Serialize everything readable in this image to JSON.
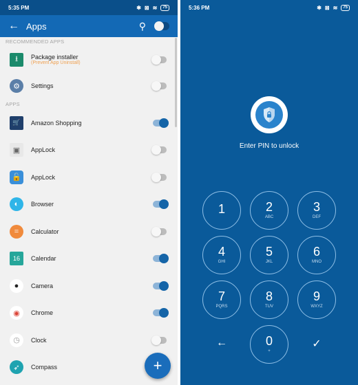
{
  "left": {
    "status": {
      "time": "5:35 PM",
      "battery": "75"
    },
    "appbar": {
      "title": "Apps"
    },
    "sections": {
      "recommended": "RECOMMENDED APPS",
      "apps": "APPS"
    },
    "recommended": [
      {
        "name": "Package installer",
        "sub": "(Prevent App Uninstall)",
        "on": false
      },
      {
        "name": "Settings",
        "on": false
      }
    ],
    "apps": [
      {
        "name": "Amazon Shopping",
        "on": true
      },
      {
        "name": "AppLock",
        "on": false
      },
      {
        "name": "AppLock",
        "on": false
      },
      {
        "name": "Browser",
        "on": true
      },
      {
        "name": "Calculator",
        "on": false
      },
      {
        "name": "Calendar",
        "on": true
      },
      {
        "name": "Camera",
        "on": true
      },
      {
        "name": "Chrome",
        "on": true
      },
      {
        "name": "Clock",
        "on": false
      },
      {
        "name": "Compass",
        "on": null
      }
    ],
    "fab": "+"
  },
  "right": {
    "status": {
      "time": "5:36 PM",
      "battery": "75"
    },
    "prompt": "Enter PIN to unlock",
    "keys": [
      {
        "num": "1",
        "letters": ""
      },
      {
        "num": "2",
        "letters": "ABC"
      },
      {
        "num": "3",
        "letters": "DEF"
      },
      {
        "num": "4",
        "letters": "GHI"
      },
      {
        "num": "5",
        "letters": "JKL"
      },
      {
        "num": "6",
        "letters": "MNO"
      },
      {
        "num": "7",
        "letters": "PQRS"
      },
      {
        "num": "8",
        "letters": "TUV"
      },
      {
        "num": "9",
        "letters": "WXYZ"
      },
      {
        "num": "0",
        "letters": "+"
      }
    ],
    "backspace": "←",
    "confirm": "✓"
  }
}
